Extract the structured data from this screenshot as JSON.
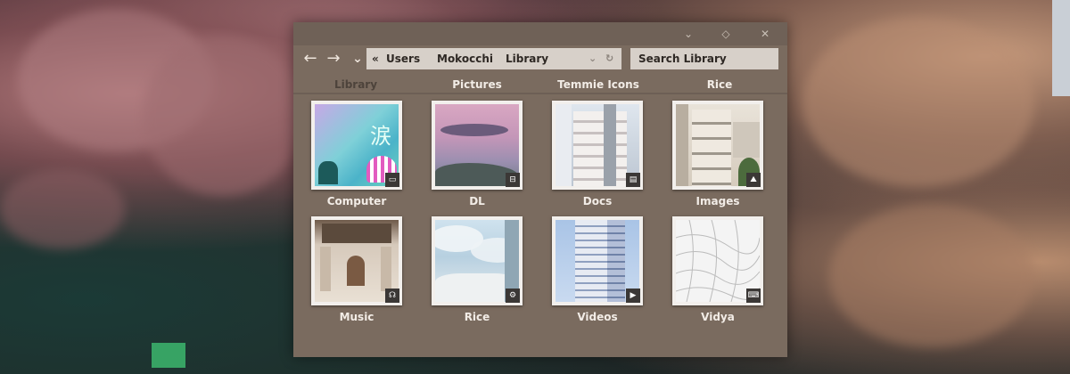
{
  "window": {
    "controls": [
      {
        "name": "minimize",
        "glyph": "⌄"
      },
      {
        "name": "maximize",
        "glyph": "◇"
      },
      {
        "name": "close",
        "glyph": "✕"
      }
    ]
  },
  "toolbar": {
    "back_glyph": "←",
    "forward_glyph": "→",
    "history_glyph": "⌄",
    "breadcrumb": {
      "overflow_glyph": "«",
      "items": [
        "Users",
        "Mokocchi",
        "Library"
      ],
      "dropdown_glyph": "⌄",
      "refresh_glyph": "↻"
    },
    "search": {
      "placeholder": "Search Library",
      "value": ""
    }
  },
  "tabs": [
    {
      "label": "Library",
      "active": true
    },
    {
      "label": "Pictures",
      "active": false
    },
    {
      "label": "Temmie Icons",
      "active": false
    },
    {
      "label": "Rice",
      "active": false
    }
  ],
  "folders": [
    {
      "label": "Computer",
      "badge_icon": "monitor-icon",
      "badge_glyph": "▭"
    },
    {
      "label": "DL",
      "badge_icon": "download-tray-icon",
      "badge_glyph": "⊟"
    },
    {
      "label": "Docs",
      "badge_icon": "document-icon",
      "badge_glyph": "▤"
    },
    {
      "label": "Images",
      "badge_icon": "mountain-image-icon",
      "badge_glyph": "⛰"
    },
    {
      "label": "Music",
      "badge_icon": "headphones-icon",
      "badge_glyph": "☊"
    },
    {
      "label": "Rice",
      "badge_icon": "settings-icon",
      "badge_glyph": "⚙"
    },
    {
      "label": "Videos",
      "badge_icon": "video-icon",
      "badge_glyph": "▶"
    },
    {
      "label": "Vidya",
      "badge_icon": "gamepad-icon",
      "badge_glyph": "⌨"
    }
  ],
  "thumbnails": {
    "computer_kanji": "涙"
  }
}
